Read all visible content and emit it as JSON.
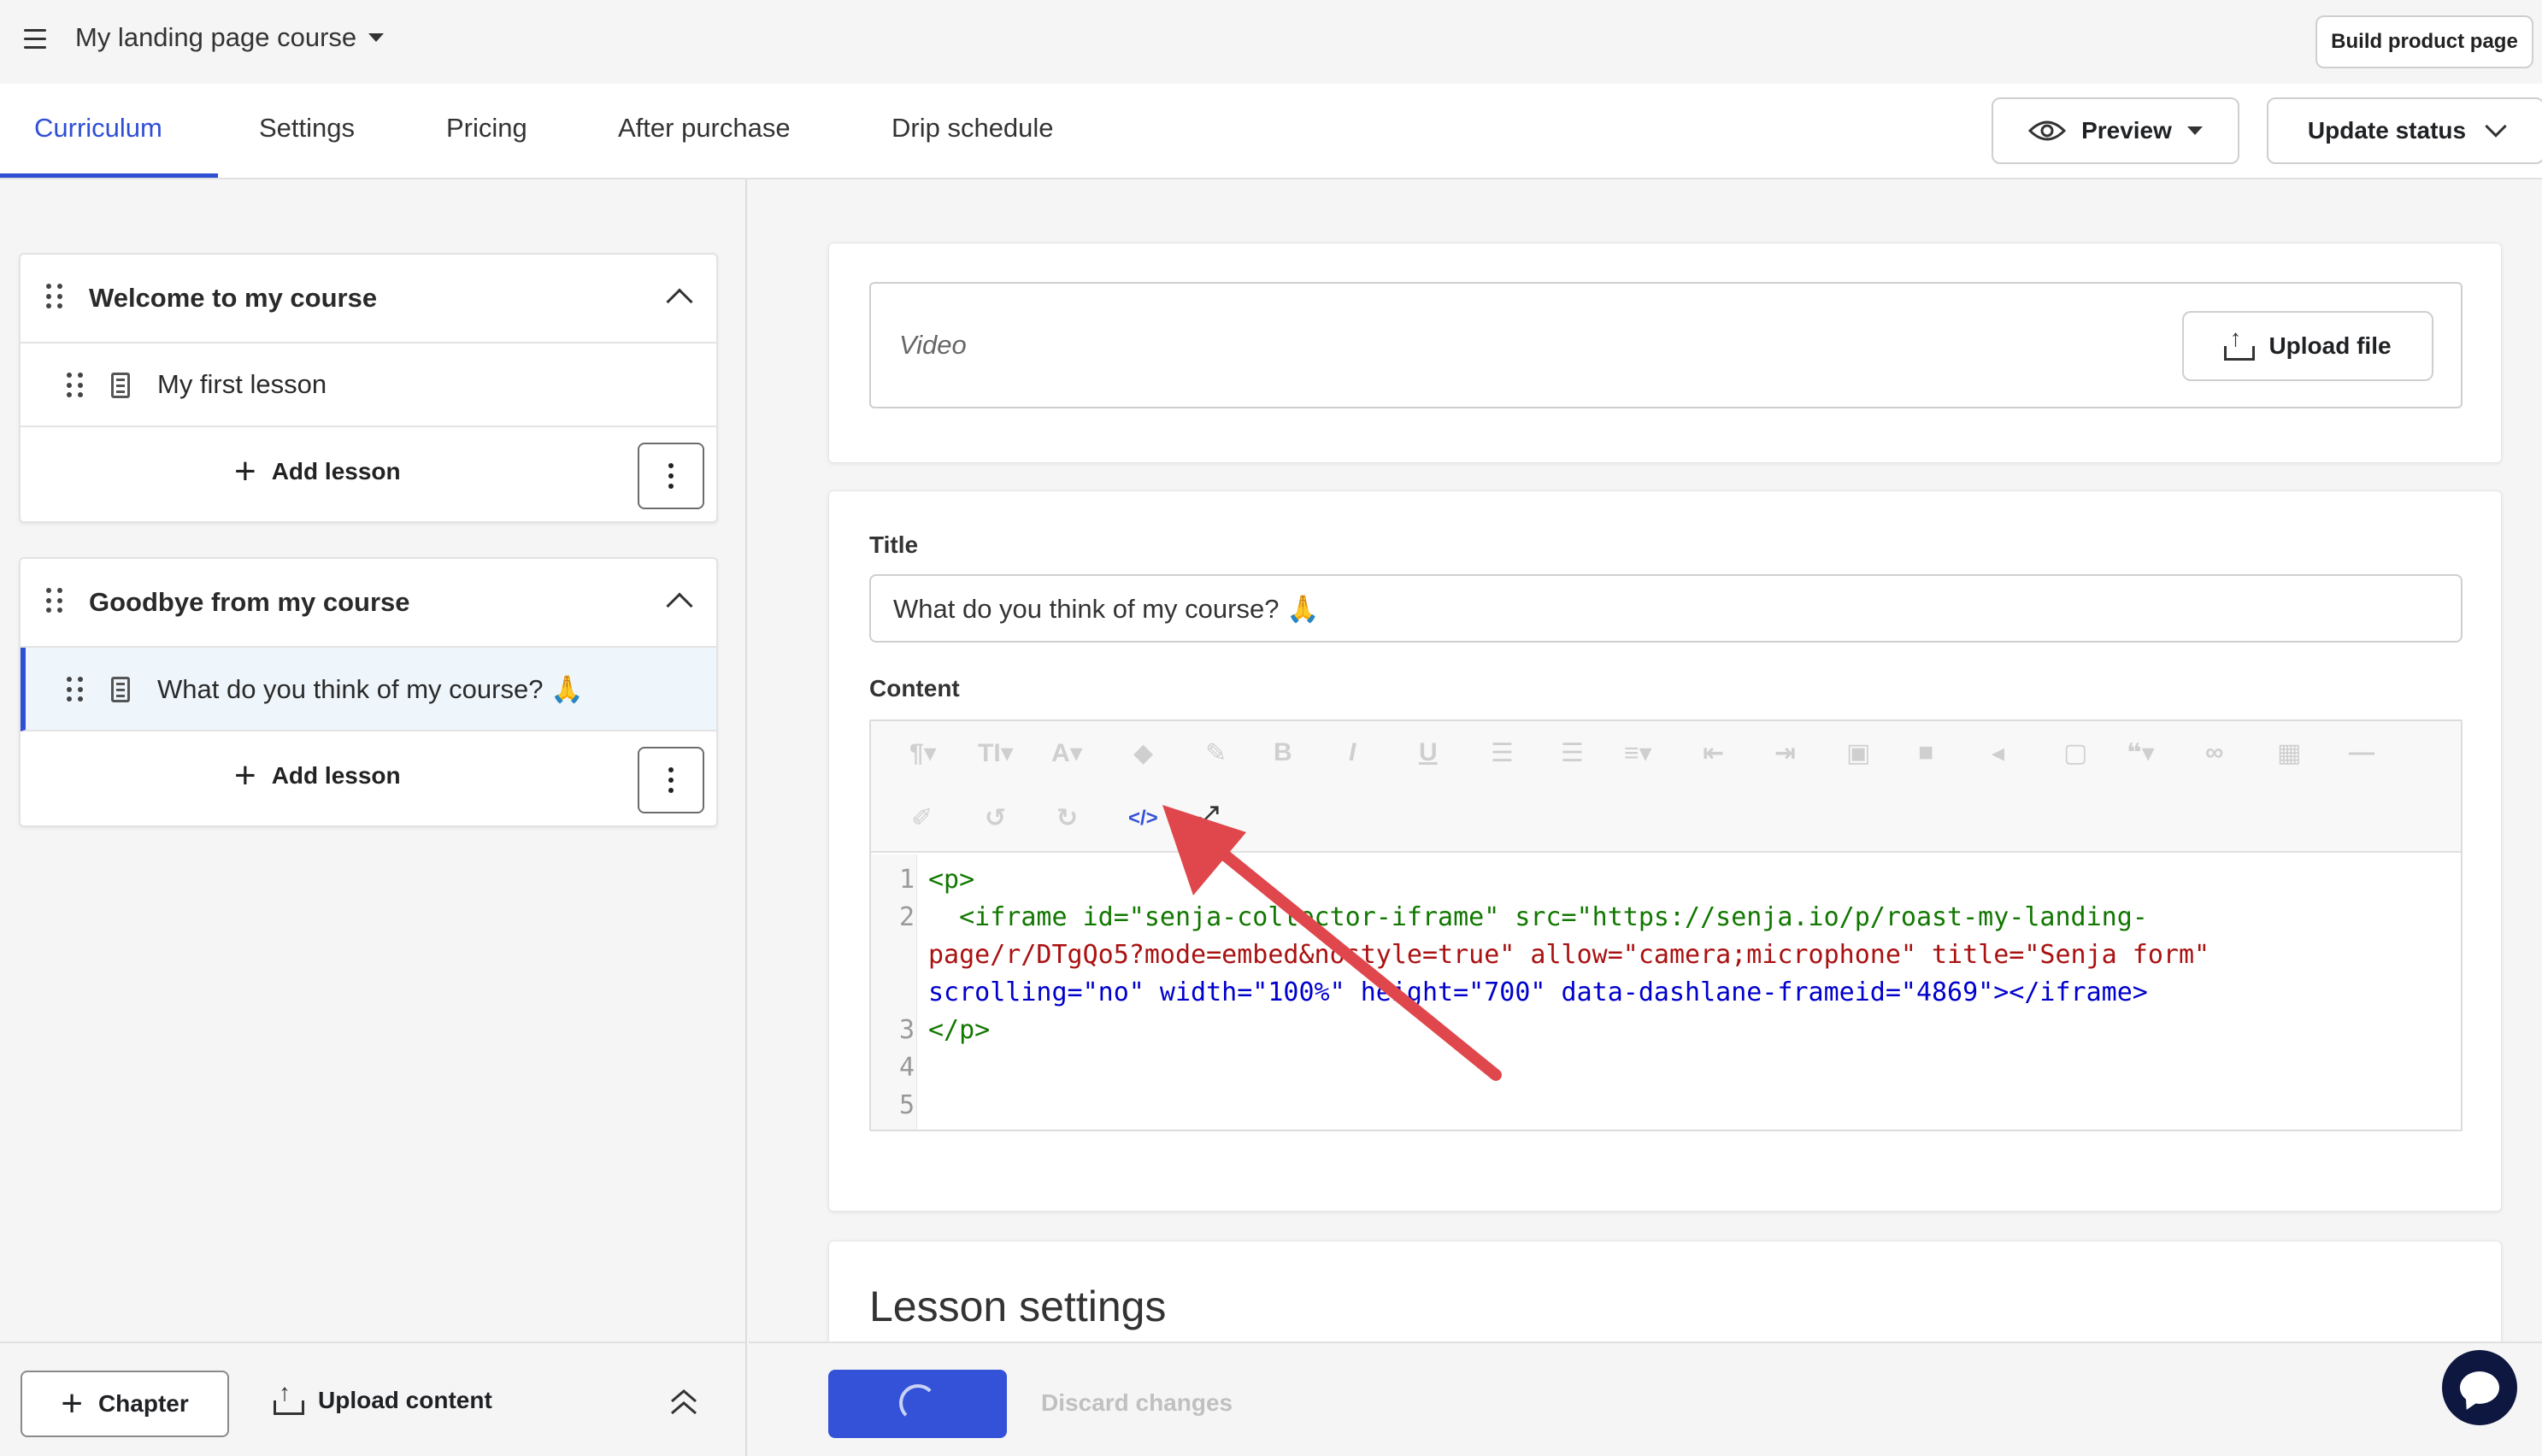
{
  "header": {
    "course_title": "My landing page course",
    "build_button": "Build product page"
  },
  "tabs": [
    {
      "label": "Curriculum",
      "active": true
    },
    {
      "label": "Settings"
    },
    {
      "label": "Pricing"
    },
    {
      "label": "After purchase"
    },
    {
      "label": "Drip schedule"
    }
  ],
  "actions": {
    "preview": "Preview",
    "update_status": "Update status"
  },
  "sidebar": {
    "chapters": [
      {
        "title": "Welcome to my course",
        "lessons": [
          {
            "title": "My first lesson",
            "active": false
          }
        ],
        "add_lesson": "Add lesson"
      },
      {
        "title": "Goodbye from my course",
        "lessons": [
          {
            "title": "What do you think of my course? 🙏",
            "active": true
          }
        ],
        "add_lesson": "Add lesson"
      }
    ],
    "footer": {
      "chapter_button": "Chapter",
      "upload_content": "Upload content"
    }
  },
  "main": {
    "video": {
      "label": "Video",
      "upload_button": "Upload file"
    },
    "title_label": "Title",
    "title_value": "What do you think of my course? 🙏",
    "content_label": "Content",
    "code_lines": [
      {
        "num": "1",
        "text": "<p>"
      },
      {
        "num": "2",
        "text": "  <iframe id=\"senja-collector-iframe\" src=\"https://senja.io/p/roast-my-landing-"
      },
      {
        "num": "",
        "text": "page/r/DTgQo5?mode=embed&nostyle=true\" allow=\"camera;microphone\" title=\"Senja form\""
      },
      {
        "num": "",
        "text": "scrolling=\"no\" width=\"100%\" height=\"700\" data-dashlane-frameid=\"4869\"></iframe>"
      },
      {
        "num": "3",
        "text": "</p>"
      },
      {
        "num": "4",
        "text": ""
      },
      {
        "num": "5",
        "text": ""
      }
    ],
    "lesson_settings": "Lesson settings",
    "discard": "Discard changes"
  },
  "colors": {
    "accent": "#2f4fd4",
    "annotation_arrow": "#e0474c",
    "chat": "#0d1740"
  }
}
